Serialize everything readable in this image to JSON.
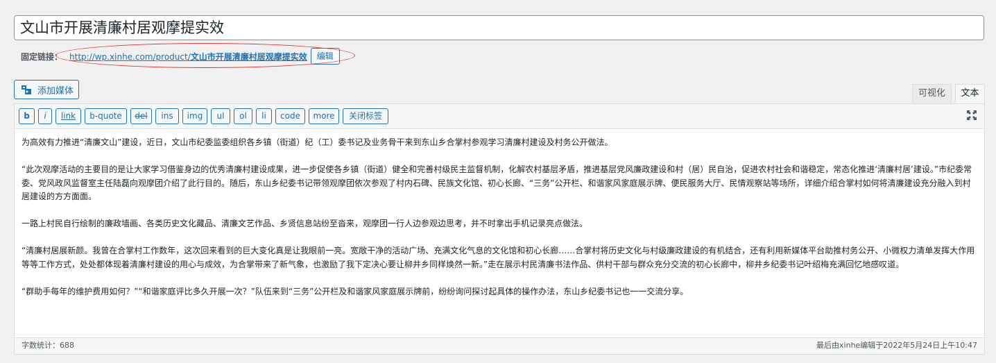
{
  "post": {
    "title": "文山市开展清廉村居观摩提实效"
  },
  "permalink": {
    "label": "固定链接：",
    "url_prefix": "http://wp.xinhe.com/product/",
    "slug": "文山市开展清廉村居观摩提实效",
    "edit_label": "编辑"
  },
  "media": {
    "add_label": "添加媒体"
  },
  "tabs": [
    {
      "label": "可视化"
    },
    {
      "label": "文本",
      "active": true
    }
  ],
  "toolbar": {
    "buttons": [
      "b",
      "i",
      "link",
      "b-quote",
      "del",
      "ins",
      "img",
      "ul",
      "ol",
      "li",
      "code",
      "more",
      "关闭标签"
    ]
  },
  "content": {
    "paragraphs": [
      "为高效有力推进“清廉文山”建设，近日，文山市纪委监委组织各乡镇（街道）纪（工）委书记及业务骨干来到东山乡合掌村参观学习清廉村建设及村务公开做法。",
      "“此次观摩活动的主要目的是让大家学习借鉴身边的优秀清廉村建设成果，进一步促使各乡镇（街道）健全和完善村级民主监督机制，化解农村基层矛盾，推进基层党风廉政建设和村（居）民自治，促进农村社会和谐稳定，常态化推进‘清廉村居’建设。”市纪委常委、党风政风监督室主任陆磊向观摩团介绍了此行目的。随后，东山乡纪委书记带领观摩团依次参观了村内石碑、民族文化馆、初心长廊、“三务”公开栏、和谐家风家庭展示牌、便民服务大厅、民情观察站等场所，详细介绍合掌村如何将清廉建设充分融入到村居建设的方方面面。",
      "一路上村民自行绘制的廉政墙画、各类历史文化藏品、清廉文艺作品、乡贤信息站纷至沓来，观摩团一行人边参观边思考，并不时拿出手机记录亮点做法。",
      "“清廉村居展新颜。我曾在合掌村工作数年，这次回来看到的巨大变化真是让我眼前一亮。宽敞干净的活动广场、充满文化气息的文化馆和初心长廊……合掌村将历史文化与村级廉政建设的有机结合，还有利用新媒体平台助推村务公开、小微权力清单发挥大作用等等工作方式，处处都体现着清廉村建设的用心与成效，为合掌带来了新气象，也激励了我下定决心要让柳井乡同样焕然一新。”走在展示村民清廉书法作品、供村干部与群众充分交流的初心长廊中，柳井乡纪委书记叶绍梅充满回忆地感叹道。",
      "“群助手每年的维护费用如何？”“和谐家庭评比多久开展一次？”队伍来到“三务”公开栏及和谐家风家庭展示牌前，纷纷询问探讨起具体的操作办法，东山乡纪委书记也一一交流分享。"
    ]
  },
  "status": {
    "word_count": "字数统计：688",
    "last_edit": "最后由xinhe编辑于2022年5月24日上午10:47"
  },
  "colors": {
    "accent": "#2271b1",
    "annotation": "#e53935"
  },
  "icons": {
    "media": "media-icon",
    "fullscreen": "fullscreen-icon"
  }
}
